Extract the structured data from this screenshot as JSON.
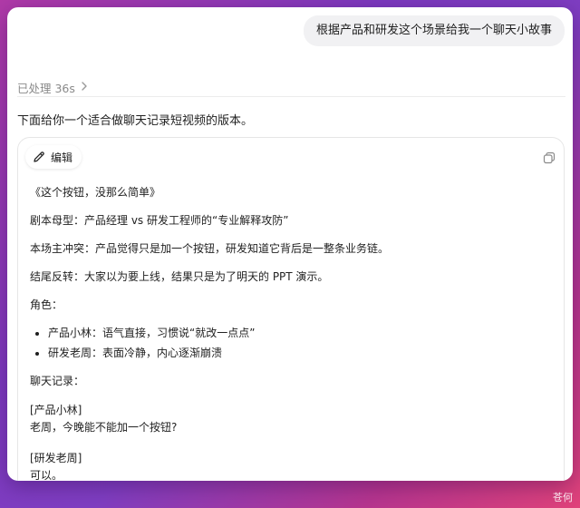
{
  "user_message": "根据产品和研发这个场景给我一个聊天小故事",
  "processed_label": "已处理 36s",
  "intro": "下面给你一个适合做聊天记录短视频的版本。",
  "card": {
    "edit_label": "编辑",
    "lines": [
      "《这个按钮，没那么简单》",
      "剧本母型：产品经理 vs 研发工程师的“专业解释攻防”",
      "本场主冲突：产品觉得只是加一个按钮，研发知道它背后是一整条业务链。",
      "结尾反转：大家以为要上线，结果只是为了明天的 PPT 演示。",
      "角色："
    ],
    "roles": [
      "产品小林：语气直接，习惯说“就改一点点”",
      "研发老周：表面冷静，内心逐渐崩溃"
    ],
    "chat_label": "聊天记录：",
    "dialogue": [
      {
        "speaker": "[产品小林]",
        "text": "老周，今晚能不能加一个按钮?"
      },
      {
        "speaker": "[研发老周]",
        "text": "可以。"
      }
    ]
  },
  "watermark": "苍何",
  "colors": {
    "bubble": "#f1f1f3",
    "muted": "#8a8a8a"
  }
}
